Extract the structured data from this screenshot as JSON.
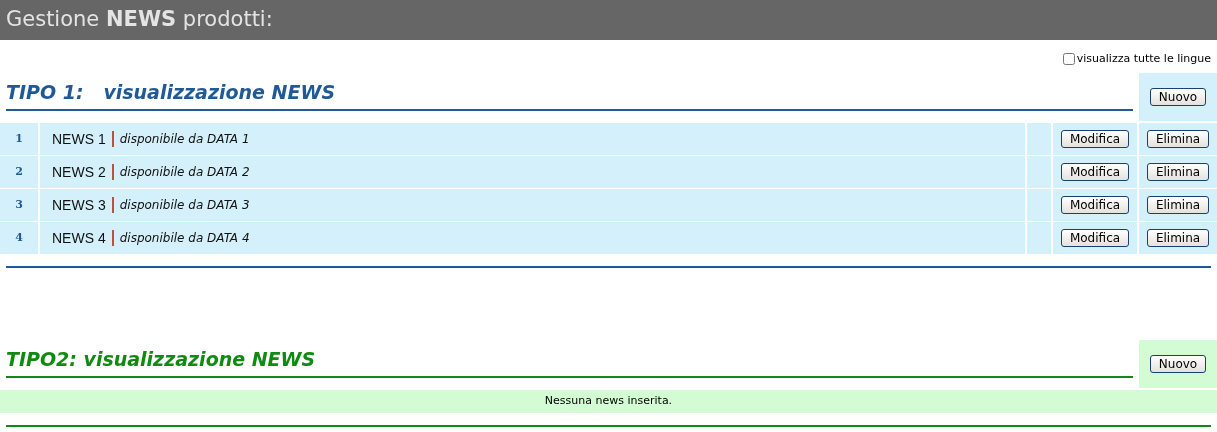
{
  "header": {
    "title": "Gestione **NEWS** prodotti:"
  },
  "show_all_languages": {
    "label": "visualizza tutte le lingue",
    "checked": false
  },
  "sections": [
    {
      "heading": "TIPO 1:   visualizzazione NEWS",
      "color": "#1f5a96",
      "new_button": "Nuovo",
      "rows": [
        {
          "number": "1",
          "title": "NEWS 1",
          "availability": "disponibile da DATA 1",
          "edit_button": "Modifica",
          "delete_button": "Elimina"
        },
        {
          "number": "2",
          "title": "NEWS 2",
          "availability": "disponibile da DATA 2",
          "edit_button": "Modifica",
          "delete_button": "Elimina"
        },
        {
          "number": "3",
          "title": "NEWS 3",
          "availability": "disponibile da DATA 3",
          "edit_button": "Modifica",
          "delete_button": "Elimina"
        },
        {
          "number": "4",
          "title": "NEWS 4",
          "availability": "disponibile da DATA 4",
          "edit_button": "Modifica",
          "delete_button": "Elimina"
        }
      ]
    },
    {
      "heading": "TIPO2: visualizzazione NEWS",
      "color": "#108a10",
      "new_button": "Nuovo",
      "empty_message": "Nessuna news inserita."
    }
  ]
}
